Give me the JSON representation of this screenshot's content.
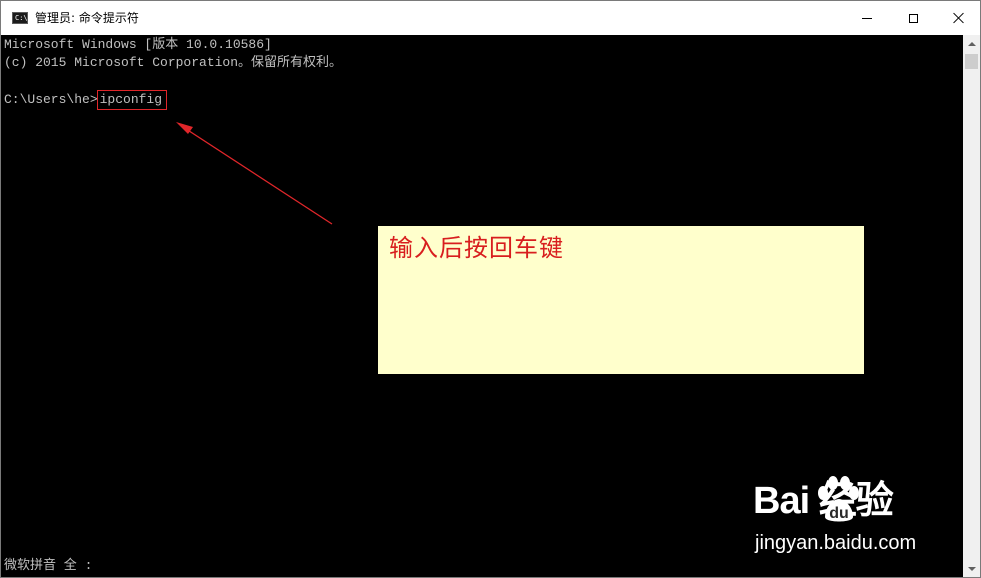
{
  "window": {
    "title": "管理员: 命令提示符",
    "icon": "console-icon",
    "icon_glyph": "C:\\",
    "controls": {
      "minimize": "minimize-icon",
      "maximize": "maximize-icon",
      "close": "close-icon"
    }
  },
  "console": {
    "line_1": "Microsoft Windows [版本 10.0.10586]",
    "line_2": "(c) 2015 Microsoft Corporation。保留所有权利。",
    "prompt": "C:\\Users\\he>",
    "typed_command": "ipconfig",
    "ime_status": "微软拼音 全 :"
  },
  "annotation": {
    "note_text": "输入后按回车键",
    "arrow_color": "#e0262a",
    "note_background": "#ffffcc",
    "note_text_color": "#d81e1e"
  },
  "watermark": {
    "logo_text": "Bai  经验",
    "url": "jingyan.baidu.com"
  },
  "colors": {
    "console_background": "#000000",
    "console_text": "#c0c0c0",
    "titlebar_background": "#ffffff"
  }
}
